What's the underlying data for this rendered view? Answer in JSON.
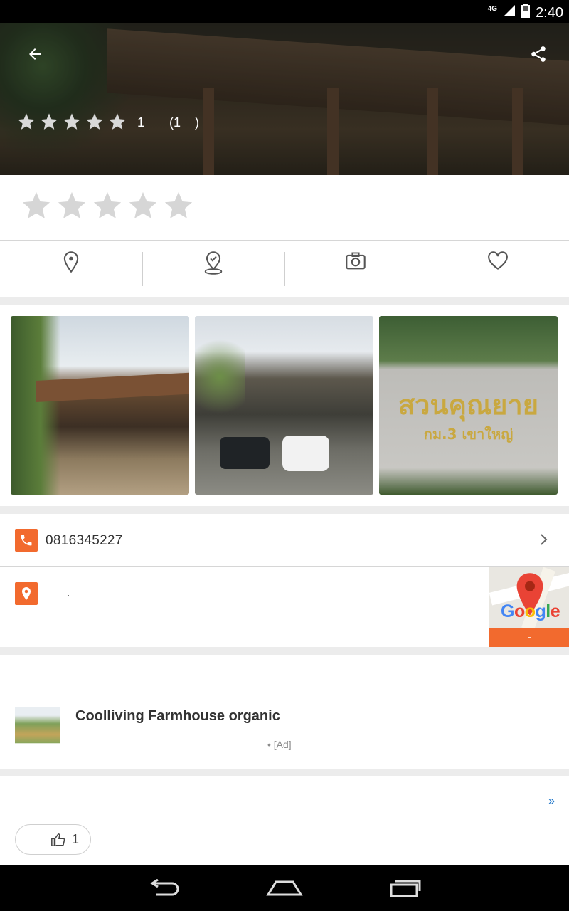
{
  "status_bar": {
    "network": "4G",
    "time": "2:40"
  },
  "hero": {
    "rating_count": "1",
    "paren_open": "(1",
    "paren_close": ")"
  },
  "actions": [
    {
      "icon": "location-pin-icon"
    },
    {
      "icon": "checkin-icon"
    },
    {
      "icon": "camera-icon"
    },
    {
      "icon": "heart-icon"
    }
  ],
  "photos": [
    {
      "alt": "restaurant-front"
    },
    {
      "alt": "parking-area"
    },
    {
      "alt": "stone-sign"
    }
  ],
  "photo_sign_text": {
    "line1": "สวนคุณยาย",
    "line2": "กม.3 เขาใหญ่"
  },
  "contact": {
    "phone": "0816345227",
    "address": "."
  },
  "map": {
    "brand": "Google",
    "bar_text": "-"
  },
  "ad": {
    "title": "Coolliving Farmhouse organic",
    "meta": "• [Ad]"
  },
  "footer": {
    "more": "»",
    "like_count": "1"
  },
  "colors": {
    "accent": "#f26a2e",
    "link": "#1a73c8"
  }
}
